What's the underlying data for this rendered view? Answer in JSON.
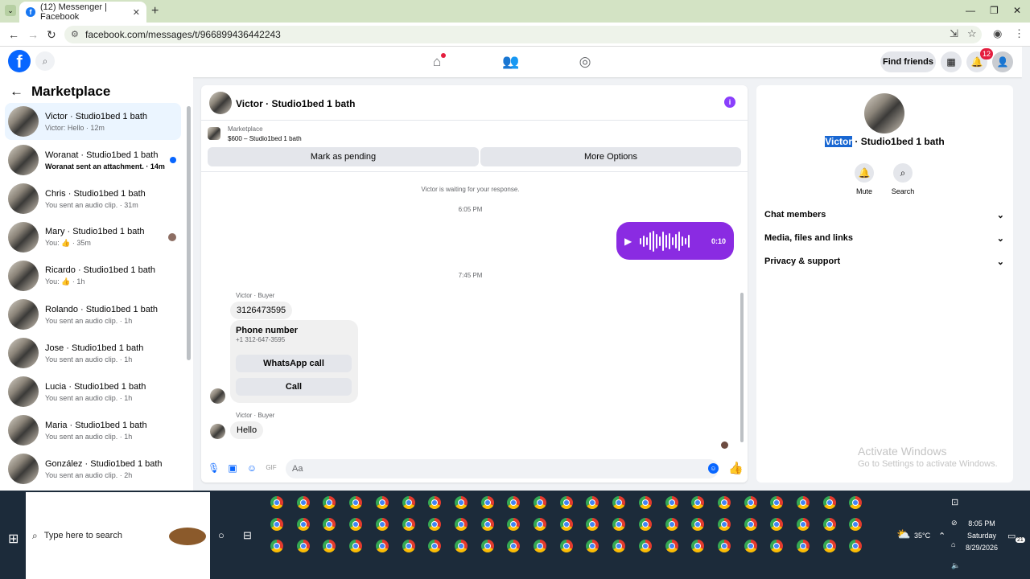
{
  "browser": {
    "tab_title": "(12) Messenger | Facebook",
    "url": "facebook.com/messages/t/966899436442243"
  },
  "header": {
    "find_friends": "Find friends",
    "notification_count": "12"
  },
  "sidebar": {
    "title": "Marketplace",
    "conversations": [
      {
        "name": "Victor · Studio1bed 1 bath",
        "snippet": "Victor: Hello · 12m"
      },
      {
        "name": "Woranat · Studio1bed 1 bath",
        "snippet": "Woranat sent an attachment. · 14m"
      },
      {
        "name": "Chris · Studio1bed 1 bath",
        "snippet": "You sent an audio clip. · 31m"
      },
      {
        "name": "Mary · Studio1bed 1 bath",
        "snippet": "You: 👍 · 35m"
      },
      {
        "name": "Ricardo · Studio1bed 1 bath",
        "snippet": "You: 👍 · 1h"
      },
      {
        "name": "Rolando · Studio1bed 1 bath",
        "snippet": "You sent an audio clip. · 1h"
      },
      {
        "name": "Jose · Studio1bed 1 bath",
        "snippet": "You sent an audio clip. · 1h"
      },
      {
        "name": "Lucia · Studio1bed 1 bath",
        "snippet": "You sent an audio clip. · 1h"
      },
      {
        "name": "Maria · Studio1bed 1 bath",
        "snippet": "You sent an audio clip. · 1h"
      },
      {
        "name": "González · Studio1bed 1 bath",
        "snippet": "You sent an audio clip. · 2h"
      }
    ]
  },
  "chat": {
    "title": "Victor · Studio1bed 1 bath",
    "listing_label": "Marketplace",
    "listing_price": "$600 – Studio1bed 1 bath",
    "mark_pending": "Mark as pending",
    "more_options": "More Options",
    "waiting_text": "Victor is waiting for your response.",
    "time1": "6:05 PM",
    "voice_duration": "0:10",
    "time2": "7:45 PM",
    "sender1": "Victor · Buyer",
    "msg_phone": "3126473595",
    "card_title": "Phone number",
    "card_number": "+1 312-647-3595",
    "whatsapp_call": "WhatsApp call",
    "call": "Call",
    "sender2": "Victor · Buyer",
    "msg_hello": "Hello",
    "composer_placeholder": "Aa"
  },
  "profile": {
    "name_highlight": "Victor",
    "name_rest": " · Studio1bed 1 bath",
    "mute": "Mute",
    "search": "Search",
    "chat_members": "Chat members",
    "media": "Media, files and links",
    "privacy": "Privacy & support"
  },
  "watermark": {
    "line1": "Activate Windows",
    "line2": "Go to Settings to activate Windows."
  },
  "taskbar": {
    "search_placeholder": "Type here to search",
    "temperature": "35°C",
    "time": "8:05 PM",
    "day": "Saturday",
    "date": "8/29/2026",
    "notif_count": "21"
  }
}
